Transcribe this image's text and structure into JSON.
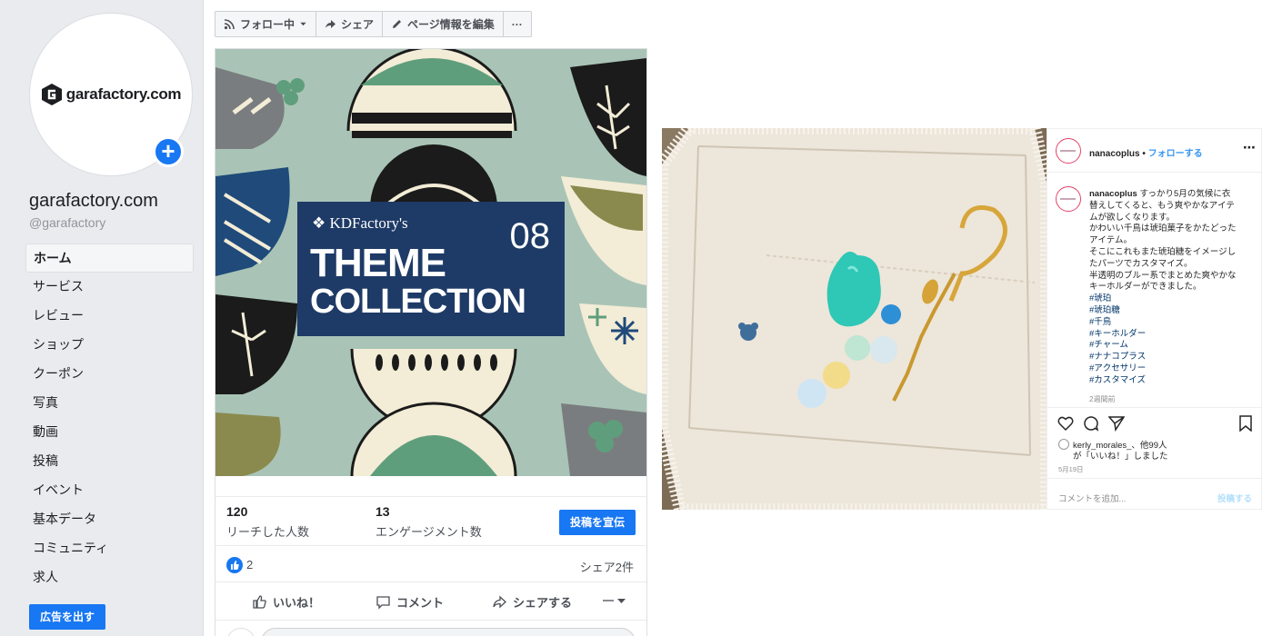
{
  "facebook": {
    "logo_text": "garafactory.com",
    "page_name": "garafactory.com",
    "page_handle": "@garafactory",
    "nav": [
      {
        "label": "ホーム",
        "active": true
      },
      {
        "label": "サービス"
      },
      {
        "label": "レビュー"
      },
      {
        "label": "ショップ"
      },
      {
        "label": "クーポン"
      },
      {
        "label": "写真"
      },
      {
        "label": "動画"
      },
      {
        "label": "投稿"
      },
      {
        "label": "イベント"
      },
      {
        "label": "基本データ"
      },
      {
        "label": "コミュニティ"
      },
      {
        "label": "求人"
      }
    ],
    "ad_button": "広告を出す",
    "action_bar": {
      "follow": "フォロー中",
      "share": "シェア",
      "edit": "ページ情報を編集",
      "more": "···"
    },
    "post": {
      "image": {
        "brand": "KDFactory's",
        "number": "08",
        "title_line1": "THEME",
        "title_line2": "COLLECTION"
      },
      "reach_count": "120",
      "reach_label": "リーチした人数",
      "engagement_count": "13",
      "engagement_label": "エンゲージメント数",
      "promote_button": "投稿を宣伝",
      "like_count": "2",
      "share_count": "シェア2件",
      "like_button": "いいね！",
      "comment_button": "コメント",
      "share_button": "シェアする"
    }
  },
  "instagram": {
    "username": "nanacoplus",
    "follow_label": "フォローする",
    "caption_lines": [
      "すっかり5月の気候に衣",
      "替えしてくると、もう爽やかなアイテ",
      "ムが欲しくなります。",
      "かわいい千鳥は琥珀菓子をかたどった",
      "アイテム。",
      "そこにこれもまた琥珀糖をイメージし",
      "たパーツでカスタマイズ。",
      "半透明のブルー系でまとめた爽やかな",
      "キーホルダーができました。"
    ],
    "hashtags": [
      "#琥珀",
      "#琥珀糖",
      "#千鳥",
      "#キーホルダー",
      "#チャーム",
      "#ナナコプラス",
      "#アクセサリー",
      "#カスタマイズ"
    ],
    "time_ago": "2週間前",
    "likes_user": "kerly_morales_、他99人",
    "likes_suffix": "が「いいね！」しました",
    "date": "5月19日",
    "comment_placeholder": "コメントを追加...",
    "post_button": "投稿する"
  }
}
